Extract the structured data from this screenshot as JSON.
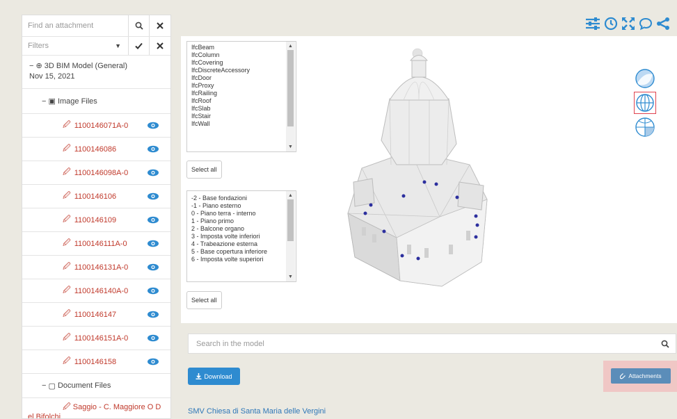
{
  "sidebar": {
    "search_placeholder": "Find an attachment",
    "filters_label": "Filters",
    "model_label": "3D BIM Model (General)",
    "model_date": "Nov 15, 2021",
    "image_group_label": "Image Files",
    "image_files": [
      "1100146071A-0",
      "1100146086",
      "1100146098A-0",
      "1100146106",
      "1100146109",
      "1100146111A-0",
      "1100146131A-0",
      "1100146140A-0",
      "1100146147",
      "1100146151A-0",
      "1100146158"
    ],
    "document_group_label": "Document Files",
    "document_file": "Saggio - C. Maggiore O D el Bifolchi"
  },
  "viewer": {
    "ifc_types": [
      "IfcBeam",
      "IfcColumn",
      "IfcCovering",
      "IfcDiscreteAccessory",
      "IfcDoor",
      "IfcProxy",
      "IfcRailing",
      "IfcRoof",
      "IfcSlab",
      "IfcStair",
      "IfcWall"
    ],
    "levels": [
      "-2 - Base fondazioni",
      "-1 - Piano esterno",
      "0 - Piano terra - interno",
      "1 - Piano primo",
      "2 - Balcone organo",
      "3 - Imposta volte inferiori",
      "4 - Trabeazione esterna",
      "5 - Base copertura inferiore",
      "6 - Imposta volte superiori"
    ],
    "select_all_label": "Select all"
  },
  "search_model": {
    "placeholder": "Search in the model"
  },
  "actions": {
    "download_label": "Download",
    "attachments_label": "Attachments"
  },
  "footer": {
    "project_title": "SMV Chiesa di Santa Maria delle Vergini"
  },
  "colors": {
    "accent": "#2e8bd0",
    "file_link": "#c0392b",
    "attachments_button": "#5b8db9",
    "highlight": "#f0c7c5"
  }
}
